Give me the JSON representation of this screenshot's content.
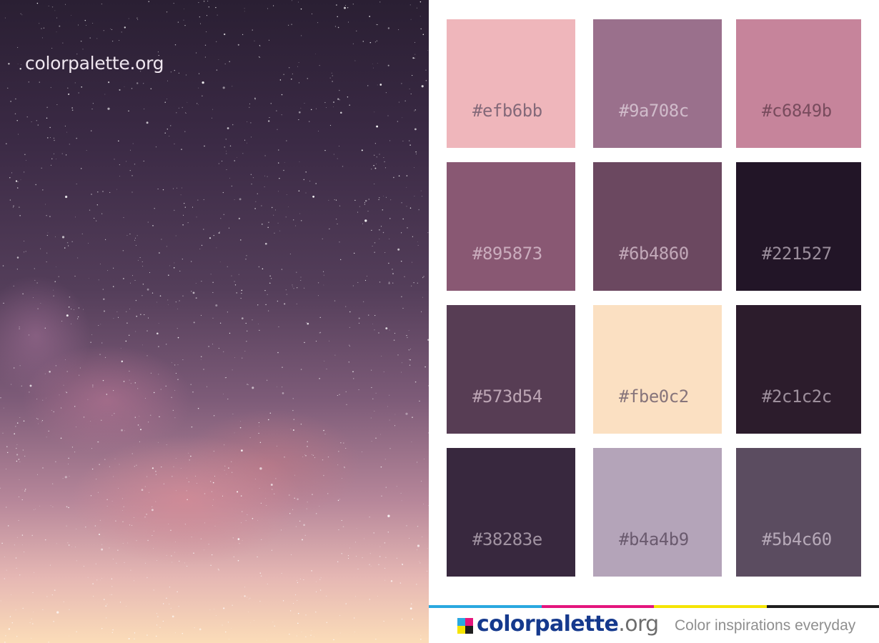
{
  "watermark": "colorpalette.org",
  "swatches": [
    {
      "hex": "#efb6bb",
      "label": "#efb6bb",
      "text_color": "#5b4c60"
    },
    {
      "hex": "#9a708c",
      "label": "#9a708c",
      "text_color": "#e6d8e2"
    },
    {
      "hex": "#c6849b",
      "label": "#c6849b",
      "text_color": "#5b3646"
    },
    {
      "hex": "#895873",
      "label": "#895873",
      "text_color": "#e3cdda"
    },
    {
      "hex": "#6b4860",
      "label": "#6b4860",
      "text_color": "#e3cdda"
    },
    {
      "hex": "#221527",
      "label": "#221527",
      "text_color": "#c9bcc8"
    },
    {
      "hex": "#573d54",
      "label": "#573d54",
      "text_color": "#e3cdda"
    },
    {
      "hex": "#fbe0c2",
      "label": "#fbe0c2",
      "text_color": "#5b4c60"
    },
    {
      "hex": "#2c1c2c",
      "label": "#2c1c2c",
      "text_color": "#c9bcc8"
    },
    {
      "hex": "#38283e",
      "label": "#38283e",
      "text_color": "#c9bcc8"
    },
    {
      "hex": "#b4a4b9",
      "label": "#b4a4b9",
      "text_color": "#4e3e52"
    },
    {
      "hex": "#5b4c60",
      "label": "#5b4c60",
      "text_color": "#d9cdda"
    }
  ],
  "footer": {
    "brand": "colorpalette",
    "brand_tld": ".org",
    "tagline": "Color inspirations everyday",
    "stripe_colors": [
      "#2aa8e0",
      "#e4157c",
      "#f5e400",
      "#1e1e1e"
    ],
    "logo_colors": [
      "#2aa8e0",
      "#e4157c",
      "#f5e400",
      "#1e1e1e"
    ]
  }
}
